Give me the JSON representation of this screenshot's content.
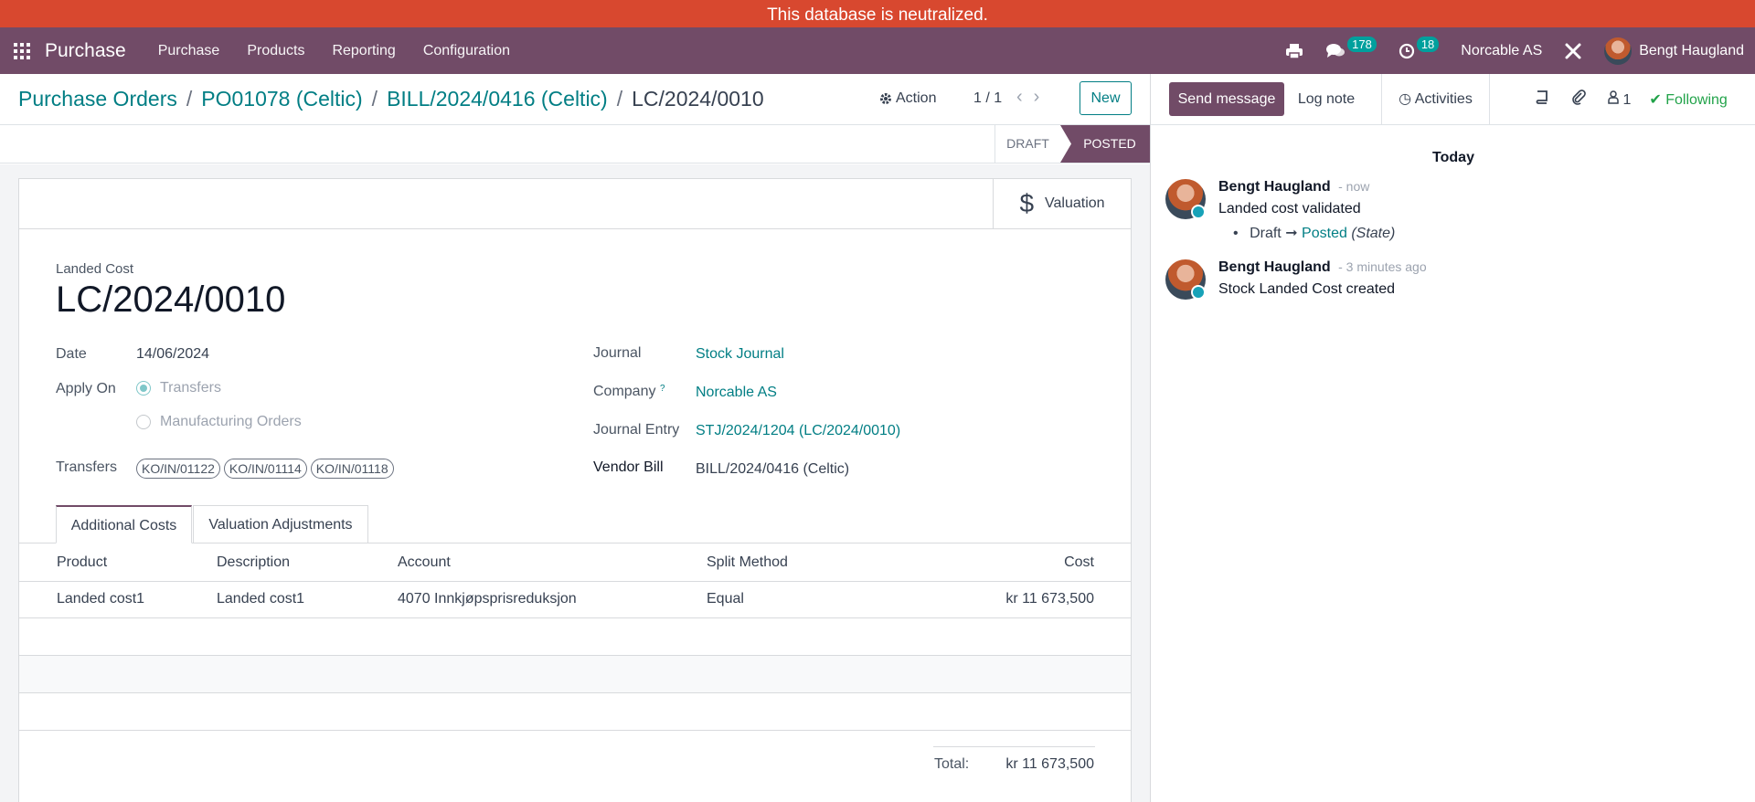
{
  "banner": {
    "text": "This database is neutralized."
  },
  "navbar": {
    "brand": "Purchase",
    "menu": [
      "Purchase",
      "Products",
      "Reporting",
      "Configuration"
    ],
    "messages_count": "178",
    "activities_count": "18",
    "company": "Norcable AS",
    "user": "Bengt Haugland"
  },
  "control": {
    "breadcrumbs": [
      "Purchase Orders",
      "PO01078 (Celtic)",
      "BILL/2024/0416 (Celtic)"
    ],
    "current": "LC/2024/0010",
    "action_label": "Action",
    "pager": "1 / 1",
    "new_label": "New"
  },
  "status": {
    "draft": "DRAFT",
    "posted": "POSTED"
  },
  "form": {
    "valuation_label": "Valuation",
    "record_type": "Landed Cost",
    "name": "LC/2024/0010",
    "date_label": "Date",
    "date_value": "14/06/2024",
    "apply_on_label": "Apply On",
    "apply_on_options": [
      "Transfers",
      "Manufacturing Orders"
    ],
    "transfers_label": "Transfers",
    "transfers": [
      "KO/IN/01122",
      "KO/IN/01114",
      "KO/IN/01118"
    ],
    "journal_label": "Journal",
    "journal_value": "Stock Journal",
    "company_label": "Company",
    "company_help": "?",
    "company_value": "Norcable AS",
    "journal_entry_label": "Journal Entry",
    "journal_entry_value": "STJ/2024/1204 (LC/2024/0010)",
    "vendor_bill_label": "Vendor Bill",
    "vendor_bill_value": "BILL/2024/0416 (Celtic)"
  },
  "tabs": [
    "Additional Costs",
    "Valuation Adjustments"
  ],
  "table": {
    "headers": [
      "Product",
      "Description",
      "Account",
      "Split Method",
      "Cost"
    ],
    "rows": [
      [
        "Landed cost1",
        "Landed cost1",
        "4070 Innkjøpsprisreduksjon",
        "Equal",
        "kr 11 673,500"
      ]
    ],
    "total_label": "Total:",
    "total_value": "kr 11 673,500"
  },
  "chatter": {
    "send_message": "Send message",
    "log_note": "Log note",
    "activities": "Activities",
    "followers_count": "1",
    "following": "Following",
    "day_separator": "Today",
    "messages": [
      {
        "author": "Bengt Haugland",
        "time": "- now",
        "body": "Landed cost validated",
        "track_old": "Draft",
        "track_new": "Posted",
        "track_field": "(State)"
      },
      {
        "author": "Bengt Haugland",
        "time": "- 3 minutes ago",
        "body": "Stock Landed Cost created"
      }
    ]
  },
  "colors": {
    "banner": "#d8482f",
    "navbar": "#714b67",
    "link": "#017e84",
    "following": "#22a34a"
  }
}
